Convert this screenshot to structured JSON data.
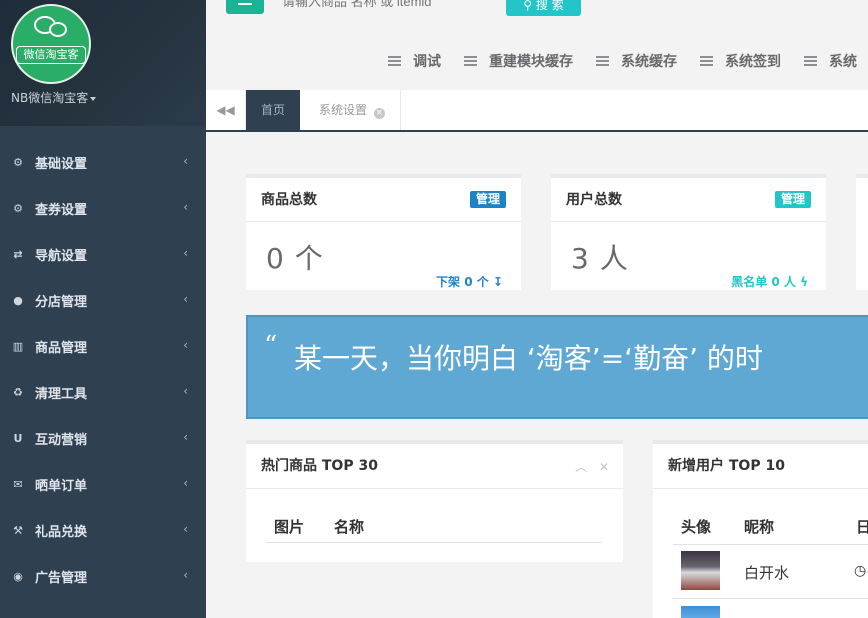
{
  "sidebar": {
    "logo_text": "微信淘宝客",
    "username": "NB微信淘宝客",
    "items": [
      {
        "icon": "cogs-icon",
        "label": "基础设置"
      },
      {
        "icon": "cogs-icon",
        "label": "查券设置"
      },
      {
        "icon": "exchange-icon",
        "label": "导航设置"
      },
      {
        "icon": "globe-icon",
        "label": "分店管理"
      },
      {
        "icon": "bar-chart-icon",
        "label": "商品管理"
      },
      {
        "icon": "recycle-icon",
        "label": "清理工具"
      },
      {
        "icon": "magnet-icon",
        "label": "互动营销"
      },
      {
        "icon": "envelope-icon",
        "label": "晒单订单"
      },
      {
        "icon": "gavel-icon",
        "label": "礼品兑换"
      },
      {
        "icon": "eye-icon",
        "label": "广告管理"
      }
    ]
  },
  "topbar": {
    "search_placeholder": "请输入商品 名称 或 itemid",
    "search_button": "搜 索",
    "tools": [
      "调试",
      "重建模块缓存",
      "系统缓存",
      "系统签到",
      "系统"
    ]
  },
  "tabs": {
    "home": "首页",
    "system_settings": "系统设置"
  },
  "cards": {
    "goods": {
      "title": "商品总数",
      "badge": "管理",
      "value": "0 个",
      "footer": "下架  0 个 ↧"
    },
    "users": {
      "title": "用户总数",
      "badge": "管理",
      "value": "3 人",
      "footer": "黑名单  0 人 ϟ"
    }
  },
  "quote": {
    "text": "某一天，当你明白 ‘淘客’=‘勤奋’ 的时"
  },
  "hot_goods": {
    "title": "热门商品 TOP 30",
    "columns": [
      "图片",
      "名称"
    ]
  },
  "new_users": {
    "title": "新增用户 TOP 10",
    "columns": [
      "头像",
      "昵称",
      "日"
    ],
    "rows": [
      {
        "nickname": "白开水"
      }
    ]
  },
  "colors": {
    "sidebar_bg": "#2f4050",
    "accent_green": "#1ab394",
    "accent_cyan": "#23c6c8",
    "accent_blue": "#1c84c6",
    "quote_bg": "#5fa8d3"
  }
}
